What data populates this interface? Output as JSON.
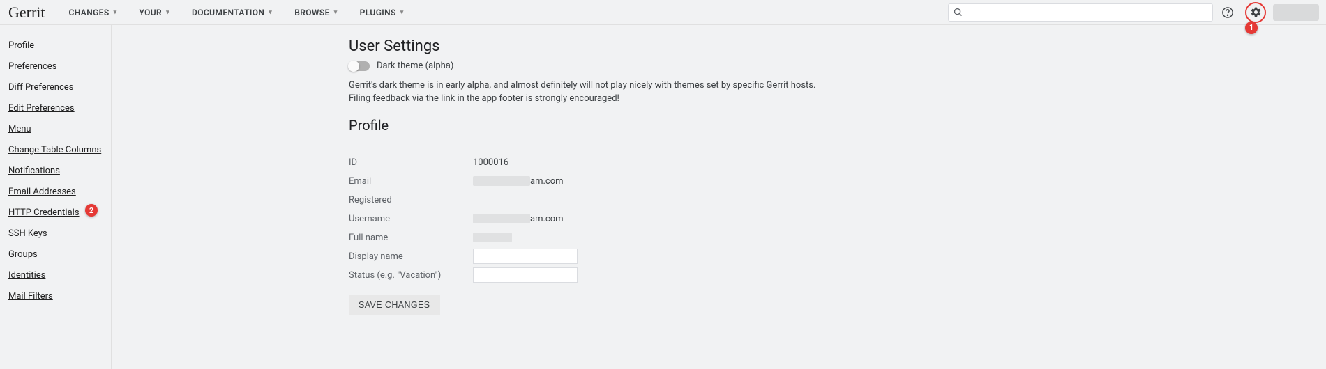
{
  "brand": "Gerrit",
  "topnav": {
    "items": [
      "CHANGES",
      "YOUR",
      "DOCUMENTATION",
      "BROWSE",
      "PLUGINS"
    ]
  },
  "search": {
    "placeholder": ""
  },
  "annotations": {
    "gear_badge": "1",
    "http_credentials_badge": "2"
  },
  "sidebar": {
    "items": [
      "Profile",
      "Preferences",
      "Diff Preferences",
      "Edit Preferences",
      "Menu",
      "Change Table Columns",
      "Notifications",
      "Email Addresses",
      "HTTP Credentials",
      "SSH Keys",
      "Groups",
      "Identities",
      "Mail Filters"
    ]
  },
  "page": {
    "title": "User Settings",
    "dark_theme_label": "Dark theme (alpha)",
    "alpha_note": "Gerrit's dark theme is in early alpha, and almost definitely will not play nicely with themes set by specific Gerrit hosts. Filing feedback via the link in the app footer is strongly encouraged!",
    "section_title": "Profile"
  },
  "profile": {
    "id_label": "ID",
    "id_value": "1000016",
    "email_label": "Email",
    "email_suffix": "am.com",
    "registered_label": "Registered",
    "username_label": "Username",
    "username_suffix": "am.com",
    "fullname_label": "Full name",
    "displayname_label": "Display name",
    "displayname_value": "",
    "status_label": "Status (e.g. \"Vacation\")",
    "status_value": "",
    "save_label": "SAVE CHANGES"
  }
}
